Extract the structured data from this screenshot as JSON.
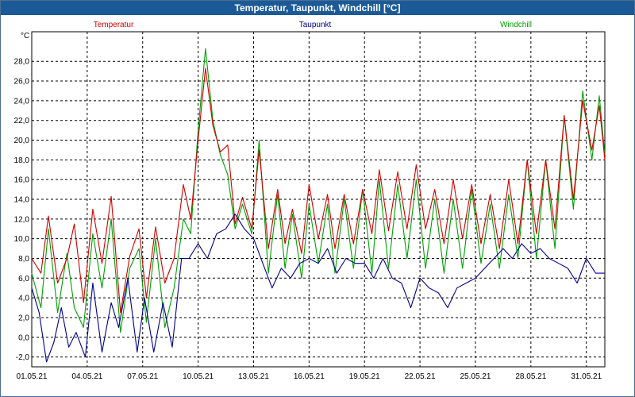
{
  "window": {
    "title": "Temperatur, Taupunkt, Windchill [°C]"
  },
  "chart_data": {
    "type": "line",
    "title": "Temperatur, Taupunkt, Windchill [°C]",
    "ylabel": "°C",
    "ylim": [
      -3.0,
      31.0
    ],
    "yticks": [
      "-2,0",
      "0,0",
      "2,0",
      "4,0",
      "6,0",
      "8,0",
      "10,0",
      "12,0",
      "14,0",
      "16,0",
      "18,0",
      "20,0",
      "22,0",
      "24,0",
      "26,0",
      "28,0"
    ],
    "ytick_values": [
      -2,
      0,
      2,
      4,
      6,
      8,
      10,
      12,
      14,
      16,
      18,
      20,
      22,
      24,
      26,
      28
    ],
    "xlim": [
      0,
      31.0
    ],
    "xticks": [
      "01.05.21",
      "04.05.21",
      "07.05.21",
      "10.05.21",
      "13.05.21",
      "16.05.21",
      "19.05.21",
      "22.05.21",
      "25.05.21",
      "28.05.21",
      "31.05.21"
    ],
    "xtick_values": [
      0,
      3,
      6,
      9,
      12,
      15,
      18,
      21,
      24,
      27,
      30
    ],
    "grid": true,
    "legend_position": "top",
    "series": [
      {
        "name": "Temperatur",
        "color": "#d00000",
        "x": [
          0,
          0.5,
          0.9,
          1.4,
          1.9,
          2.3,
          2.8,
          3.3,
          3.8,
          4.3,
          4.8,
          5.3,
          5.8,
          6.2,
          6.7,
          7.2,
          7.7,
          8.2,
          8.6,
          9.0,
          9.4,
          9.8,
          10.2,
          10.6,
          11.0,
          11.4,
          11.9,
          12.3,
          12.8,
          13.3,
          13.7,
          14.1,
          14.6,
          15.0,
          15.5,
          16.0,
          16.4,
          16.9,
          17.4,
          17.9,
          18.4,
          18.8,
          19.3,
          19.8,
          20.3,
          20.8,
          21.3,
          21.8,
          22.3,
          22.8,
          23.3,
          23.8,
          24.3,
          24.8,
          25.3,
          25.8,
          26.3,
          26.8,
          27.3,
          27.8,
          28.3,
          28.8,
          29.3,
          29.8,
          30.3,
          30.7,
          31.0
        ],
        "values": [
          8.0,
          6.5,
          12.3,
          5.5,
          8.0,
          11.5,
          3.5,
          13.0,
          7.5,
          14.3,
          2.5,
          8.2,
          11.0,
          4.0,
          11.2,
          5.5,
          8.0,
          15.5,
          12.0,
          20.0,
          27.3,
          21.5,
          18.8,
          19.5,
          11.5,
          14.2,
          11.0,
          19.0,
          9.0,
          15.0,
          9.5,
          13.0,
          8.5,
          15.5,
          10.0,
          14.5,
          9.0,
          14.5,
          9.5,
          15.0,
          10.5,
          17.0,
          10.8,
          16.8,
          11.0,
          17.5,
          11.0,
          15.0,
          9.5,
          16.0,
          10.0,
          15.5,
          9.5,
          14.5,
          9.0,
          16.0,
          9.5,
          18.0,
          10.5,
          18.0,
          11.0,
          22.5,
          14.0,
          24.0,
          19.0,
          23.5,
          18.0
        ]
      },
      {
        "name": "Taupunkt",
        "color": "#00008b",
        "x": [
          0,
          0.4,
          0.8,
          1.2,
          1.6,
          2.0,
          2.4,
          2.9,
          3.3,
          3.8,
          4.3,
          4.7,
          5.2,
          5.7,
          6.1,
          6.6,
          7.1,
          7.6,
          8.1,
          8.5,
          9.0,
          9.5,
          10.0,
          10.5,
          11.0,
          11.5,
          12.0,
          12.5,
          13.0,
          13.5,
          14.0,
          14.5,
          15.0,
          15.5,
          16.0,
          16.5,
          17.0,
          17.5,
          18.0,
          18.5,
          19.0,
          19.5,
          20.0,
          20.5,
          21.0,
          21.5,
          22.0,
          22.5,
          23.0,
          23.5,
          24.0,
          24.5,
          25.0,
          25.5,
          26.0,
          26.5,
          27.0,
          27.5,
          28.0,
          28.5,
          29.0,
          29.5,
          30.0,
          30.5,
          31.0
        ],
        "values": [
          5.0,
          2.5,
          -2.5,
          -0.5,
          3.0,
          -1.0,
          0.5,
          -2.0,
          5.5,
          -1.5,
          3.5,
          1.0,
          6.0,
          -1.5,
          4.0,
          -1.5,
          3.5,
          -1.0,
          8.0,
          8.0,
          9.5,
          8.0,
          10.5,
          11.0,
          12.5,
          11.0,
          10.0,
          7.5,
          5.0,
          7.0,
          6.0,
          7.5,
          8.0,
          7.5,
          9.0,
          6.5,
          8.0,
          7.5,
          7.5,
          6.0,
          8.0,
          6.0,
          5.5,
          3.0,
          6.0,
          5.0,
          4.5,
          3.0,
          5.0,
          5.5,
          6.0,
          7.0,
          8.0,
          9.0,
          8.0,
          9.5,
          8.5,
          9.0,
          8.0,
          7.5,
          7.0,
          5.5,
          8.0,
          6.5,
          6.5
        ]
      },
      {
        "name": "Windchill",
        "color": "#00a000",
        "x": [
          0,
          0.5,
          0.9,
          1.4,
          1.9,
          2.3,
          2.8,
          3.3,
          3.8,
          4.3,
          4.8,
          5.3,
          5.8,
          6.2,
          6.7,
          7.2,
          7.7,
          8.2,
          8.6,
          9.0,
          9.4,
          9.8,
          10.2,
          10.6,
          11.0,
          11.4,
          11.9,
          12.3,
          12.8,
          13.3,
          13.7,
          14.1,
          14.6,
          15.0,
          15.5,
          16.0,
          16.4,
          16.9,
          17.4,
          17.9,
          18.4,
          18.8,
          19.3,
          19.8,
          20.3,
          20.8,
          21.3,
          21.8,
          22.3,
          22.8,
          23.3,
          23.8,
          24.3,
          24.8,
          25.3,
          25.8,
          26.3,
          26.8,
          27.3,
          27.8,
          28.3,
          28.8,
          29.3,
          29.8,
          30.3,
          30.7,
          31.0
        ],
        "values": [
          6.5,
          3.0,
          11.0,
          2.5,
          8.5,
          3.0,
          1.0,
          10.5,
          5.0,
          12.0,
          0.5,
          7.0,
          9.0,
          1.5,
          10.0,
          1.0,
          5.0,
          12.0,
          10.5,
          21.0,
          29.3,
          22.0,
          18.5,
          16.5,
          11.0,
          13.5,
          10.5,
          20.0,
          6.5,
          14.5,
          7.0,
          12.5,
          6.0,
          13.5,
          7.5,
          13.5,
          6.5,
          14.0,
          7.0,
          15.0,
          6.5,
          16.0,
          7.0,
          15.5,
          8.0,
          16.0,
          7.0,
          14.0,
          6.5,
          14.0,
          7.0,
          15.0,
          7.5,
          13.5,
          7.0,
          14.5,
          8.0,
          18.0,
          8.0,
          18.0,
          9.0,
          22.5,
          13.0,
          25.0,
          18.0,
          24.5,
          18.5
        ]
      }
    ]
  }
}
